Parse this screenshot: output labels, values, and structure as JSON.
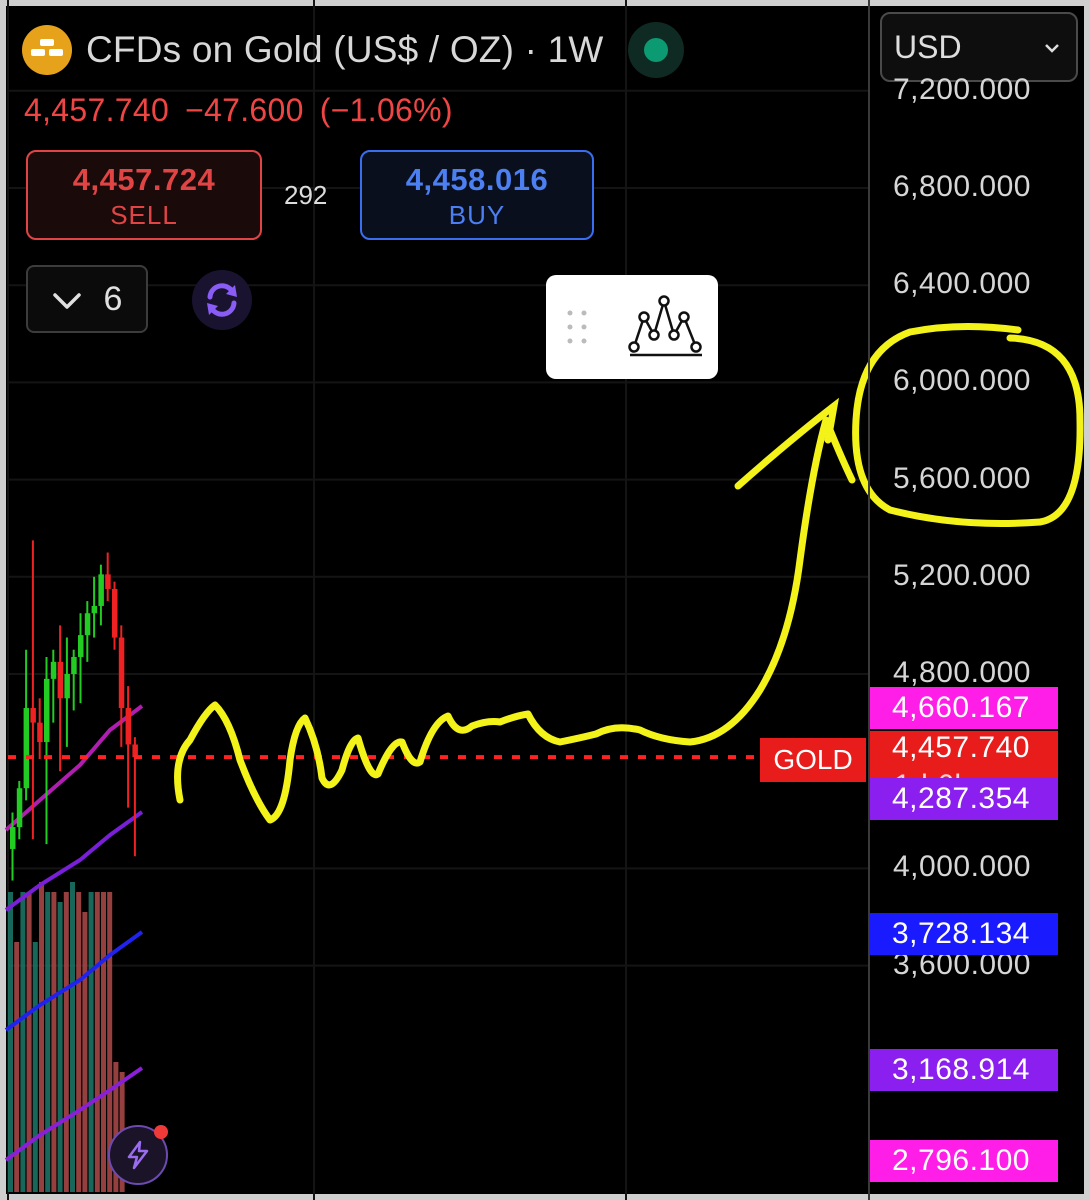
{
  "header": {
    "title": "CFDs on Gold (US$ / OZ) · 1W",
    "last_price": "4,457.740",
    "change": "−47.600",
    "change_pct": "(−1.06%)"
  },
  "trade": {
    "sell_price": "4,457.724",
    "sell_label": "SELL",
    "spread": "292",
    "buy_price": "4,458.016",
    "buy_label": "BUY"
  },
  "controls": {
    "indicator_count": "6",
    "currency": "USD"
  },
  "colors": {
    "bg": "#000000",
    "sell": "#e04444",
    "buy": "#3a6ef0",
    "up_candle": "#22cc22",
    "down_candle": "#ee2222",
    "annotation": "#f3f31a",
    "gold_badge": "#e91c1c"
  },
  "chart_data": {
    "type": "candlestick",
    "ylim": [
      2700,
      7300
    ],
    "yticks": [
      "7,200.000",
      "6,800.000",
      "6,400.000",
      "6,000.000",
      "5,600.000",
      "5,200.000",
      "4,800.000",
      "4,000.000",
      "3,600.000"
    ],
    "current_price_label": "GOLD",
    "current_price": "4,457.740",
    "countdown": "1d 6h",
    "price_badges": [
      {
        "value": "4,660.167",
        "color": "#ff1ee8"
      },
      {
        "value": "4,287.354",
        "color": "#8a1ff0"
      },
      {
        "value": "3,728.134",
        "color": "#1a1aff"
      },
      {
        "value": "3,168.914",
        "color": "#8a1ff0"
      },
      {
        "value": "2,796.100",
        "color": "#ff1ee8"
      }
    ],
    "candles": [
      {
        "o": 4080,
        "h": 4230,
        "l": 3950,
        "c": 4170
      },
      {
        "o": 4170,
        "h": 4360,
        "l": 4120,
        "c": 4330
      },
      {
        "o": 4330,
        "h": 4900,
        "l": 4280,
        "c": 4660
      },
      {
        "o": 4660,
        "h": 5350,
        "l": 4120,
        "c": 4600
      },
      {
        "o": 4600,
        "h": 4700,
        "l": 4450,
        "c": 4520
      },
      {
        "o": 4520,
        "h": 4870,
        "l": 4100,
        "c": 4780
      },
      {
        "o": 4780,
        "h": 4900,
        "l": 4600,
        "c": 4850
      },
      {
        "o": 4850,
        "h": 5000,
        "l": 4400,
        "c": 4700
      },
      {
        "o": 4700,
        "h": 4950,
        "l": 4500,
        "c": 4800
      },
      {
        "o": 4800,
        "h": 4900,
        "l": 4650,
        "c": 4870
      },
      {
        "o": 4870,
        "h": 5050,
        "l": 4680,
        "c": 4960
      },
      {
        "o": 4960,
        "h": 5100,
        "l": 4850,
        "c": 5050
      },
      {
        "o": 5050,
        "h": 5200,
        "l": 4950,
        "c": 5080
      },
      {
        "o": 5080,
        "h": 5250,
        "l": 5000,
        "c": 5210
      },
      {
        "o": 5210,
        "h": 5300,
        "l": 5100,
        "c": 5150
      },
      {
        "o": 5150,
        "h": 5180,
        "l": 4900,
        "c": 4950
      },
      {
        "o": 4950,
        "h": 5000,
        "l": 4500,
        "c": 4660
      },
      {
        "o": 4660,
        "h": 4750,
        "l": 4250,
        "c": 4510
      },
      {
        "o": 4510,
        "h": 4540,
        "l": 4050,
        "c": 4458
      }
    ],
    "volume_colors": [
      "up",
      "down",
      "up",
      "down",
      "up",
      "down",
      "up",
      "down",
      "up",
      "down",
      "up",
      "down",
      "down",
      "up",
      "down",
      "down",
      "down",
      "down",
      "down"
    ]
  }
}
